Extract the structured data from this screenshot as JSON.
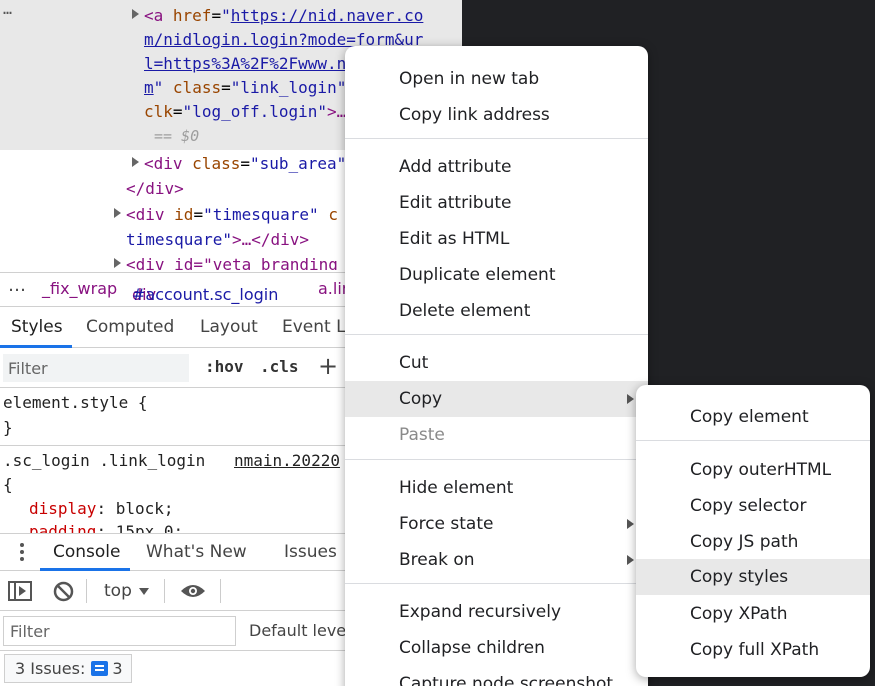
{
  "elements_tree": {
    "ellipsis": "…",
    "anchor_open": "<a",
    "href_attr": "href",
    "href_value_parts": [
      "https://nid.naver.co",
      "m/nidlogin.login?mode=form&ur",
      "l=https%3A%2F%2Fwww.n"
    ],
    "href_close_quote": "\"",
    "m_part": "m",
    "class_attr": "class",
    "class_value": "\"link_login\"",
    "clk_attr": "clk",
    "clk_value": "\"log_off.login\"",
    "clk_suffix": ">…",
    "dollar_zero": "== $0",
    "div_sub_area_open": "<div",
    "div_sub_area_attr": "class",
    "div_sub_area_value": "\"sub_area\"",
    "div_close": "</div>",
    "timesquare_open": "<div",
    "timesquare_attr": "id",
    "timesquare_value": "\"timesquare\"",
    "timesquare_cont_attr": "c",
    "timesquare_cont_value": "timesquare\"",
    "timesquare_end": ">…</div>",
    "veta_line": "<div id=\"veta_branding"
  },
  "breadcrumb": {
    "ellipsis": "…",
    "crumb1": "_fix_wrap",
    "crumb2_tag": "div",
    "crumb2_id": "#account.sc_login",
    "crumb3_tag": "a.lin"
  },
  "panel_tabs": [
    "Styles",
    "Computed",
    "Layout",
    "Event Lis"
  ],
  "styles_filter": {
    "placeholder": "Filter",
    "hov": ":hov",
    "cls": ".cls",
    "plus": "+"
  },
  "styles_pane": {
    "element_style_selector": "element.style {",
    "element_style_close": "}",
    "rule_selector": ".sc_login .link_login",
    "rule_source": "nmain.20220",
    "rule_open": "{",
    "prop1_name": "display",
    "prop1_value": "block;",
    "prop2_name": "padding",
    "prop2_value": "15px 0;"
  },
  "drawer": {
    "tabs": [
      "Console",
      "What's New",
      "Issues"
    ],
    "context": "top",
    "filter_placeholder": "Filter",
    "default_levels": "Default level",
    "issues_label": "3 Issues:",
    "issues_count": "3"
  },
  "context_menu": {
    "items": [
      "Open in new tab",
      "Copy link address",
      "Add attribute",
      "Edit attribute",
      "Edit as HTML",
      "Duplicate element",
      "Delete element",
      "Cut",
      "Copy",
      "Paste",
      "Hide element",
      "Force state",
      "Break on",
      "Expand recursively",
      "Collapse children",
      "Capture node screenshot"
    ]
  },
  "copy_submenu": {
    "items": [
      "Copy element",
      "Copy outerHTML",
      "Copy selector",
      "Copy JS path",
      "Copy styles",
      "Copy XPath",
      "Copy full XPath"
    ]
  },
  "colors": {
    "tag": "#881280",
    "attribute": "#994500",
    "value": "#1a1aa6",
    "accent": "#1a73e8",
    "dark_panel": "#202124",
    "highlight": "#e8e8e8"
  }
}
